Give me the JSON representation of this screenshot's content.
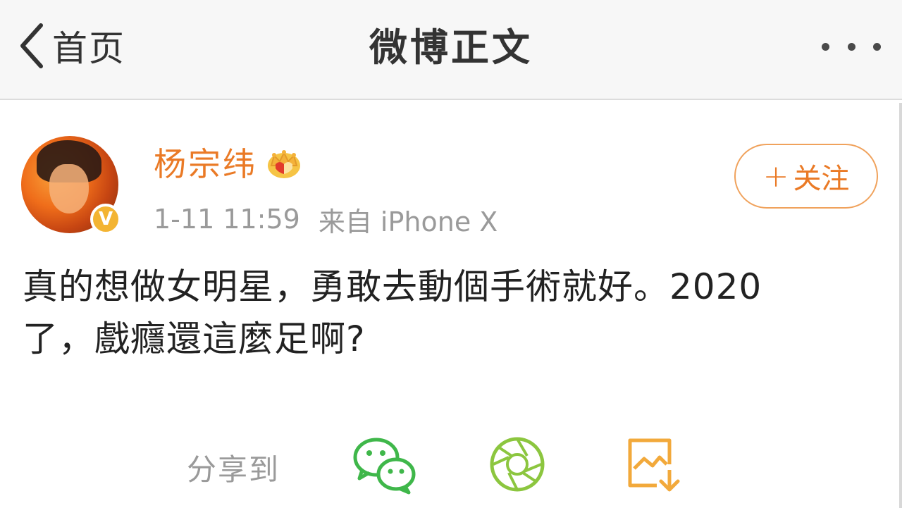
{
  "navbar": {
    "back_label": "首页",
    "title": "微博正文",
    "back_icon": "chevron-left-icon",
    "more_icon": "more-dots-icon"
  },
  "user": {
    "name": "杨宗纬",
    "badge_icon": "crown-icon",
    "verified_icon": "verified-v-icon",
    "verified_mark": "V",
    "timestamp": "1-11 11:59",
    "source": "来自 iPhone X"
  },
  "follow_button": {
    "plus": "+",
    "label": "关注"
  },
  "post": {
    "text_line1": "真的想做女明星，勇敢去動個手術就好。2020",
    "text_line2": "了，戲癮還這麼足啊?"
  },
  "share": {
    "label": "分享到",
    "targets": [
      {
        "icon": "wechat-icon"
      },
      {
        "icon": "wechat-moments-icon"
      },
      {
        "icon": "save-image-icon"
      }
    ]
  },
  "colors": {
    "accent": "#ea7a26",
    "follow_border": "#f0a25c",
    "wechat": "#3fb74a",
    "moments": "#8cc63f",
    "save": "#f2a93b",
    "meta_text": "#9a9a9a",
    "body_text": "#222222"
  }
}
